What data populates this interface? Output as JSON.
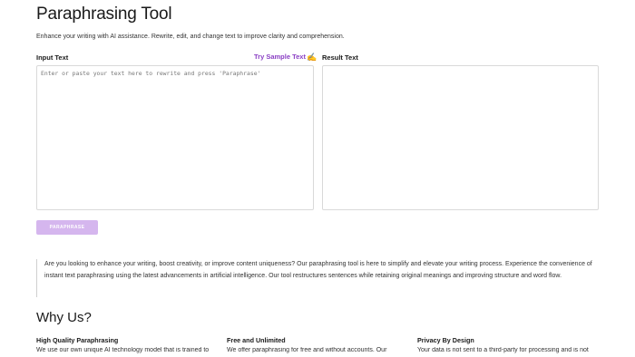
{
  "header": {
    "title": "Paraphrasing Tool",
    "subtitle": "Enhance your writing with AI assistance. Rewrite, edit, and change text to improve clarity and comprehension."
  },
  "input": {
    "label": "Input Text",
    "placeholder": "Enter or paste your text here to rewrite and press 'Paraphrase'",
    "value": ""
  },
  "sample_link": {
    "label": "Try Sample Text",
    "icon": "writing-hand-icon"
  },
  "result": {
    "label": "Result Text",
    "value": ""
  },
  "paraphrase_button": {
    "label": "PARAPHRASE",
    "color": "#d5b6ee"
  },
  "intro": {
    "text": "Are you looking to enhance your writing, boost creativity, or improve content uniqueness? Our paraphrasing tool is here to simplify and elevate your writing process. Experience the convenience of instant text paraphrasing using the latest advancements in artificial intelligence. Our tool restructures sentences while retaining original meanings and improving structure and word flow."
  },
  "why_us": {
    "heading": "Why Us?",
    "features": [
      {
        "title": "High Quality Paraphrasing",
        "text": "We use our own unique AI technology model that is trained to"
      },
      {
        "title": "Free and Unlimited",
        "text": "We offer paraphrasing for free and without accounts. Our"
      },
      {
        "title": "Privacy By Design",
        "text": "Your data is not sent to a third-party for processing and is not"
      }
    ]
  },
  "colors": {
    "accent": "#8a3fc4",
    "button_disabled": "#d5b6ee",
    "border": "#d9d9d9"
  }
}
